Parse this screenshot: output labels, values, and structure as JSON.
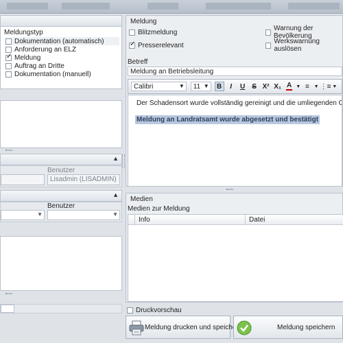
{
  "top_tabs": [
    "",
    "",
    "",
    "",
    "",
    "",
    ""
  ],
  "meldungstyp": {
    "title": "Meldungstyp",
    "items": [
      {
        "label": "Dokumentation (automatisch)",
        "checked": false
      },
      {
        "label": "Anforderung an ELZ",
        "checked": false
      },
      {
        "label": "Meldung",
        "checked": true
      },
      {
        "label": "Auftrag an Dritte",
        "checked": false
      },
      {
        "label": "Dokumentation (manuell)",
        "checked": false
      }
    ]
  },
  "left_section1": {
    "benutzer_label": "Benutzer",
    "benutzer_value": "Lisadmin (LISADMIN)"
  },
  "left_section2": {
    "benutzer_label": "Benutzer"
  },
  "meldung": {
    "title": "Meldung",
    "blitzmeldung": "Blitzmeldung",
    "presserelevant": "Presserelevant",
    "warnung": "Warnung der Bevölkerung",
    "werkswarnung": "Werkswarnung auslösen"
  },
  "betreff": {
    "label": "Betreff",
    "value": "Meldung an Betriebsleitung"
  },
  "editor": {
    "font": "Calibri",
    "size": "11",
    "bold": "B",
    "italic": "I",
    "underline": "U",
    "strike": "S",
    "superscript": "X²",
    "subscript": "X₁",
    "fontcolor": "A",
    "line1": "Der Schadensort wurde vollständig gereinigt und die umliegenden Gebäu",
    "line2": "Meldung an Landratsamt wurde abgesetzt und bestätigt"
  },
  "medien": {
    "title": "Medien",
    "sub": "Medien zur Meldung",
    "col_info": "Info",
    "col_datei": "Datei"
  },
  "druckvorschau": "Druckvorschau",
  "buttons": {
    "print_save": "Meldung drucken und speichern",
    "save": "Meldung speichern"
  }
}
